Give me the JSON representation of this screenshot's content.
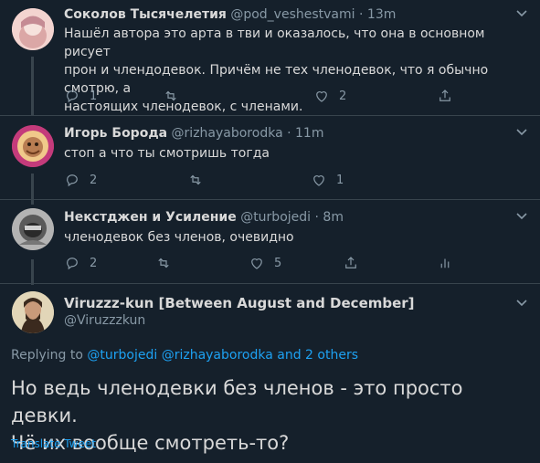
{
  "colors": {
    "background": "#15202b",
    "text": "#d9d9d9",
    "muted": "#8899a6",
    "link": "#1da1f2",
    "divider": "#38444d"
  },
  "tweets": [
    {
      "name": "Соколов Тысячелетия",
      "handle": "@pod_veshestvami",
      "sep": "·",
      "time": "13m",
      "text_lines": [
        "Нашёл автора это арта в тви и оказалось, что она в основном рисует",
        "прон и члендодевок. Причём не тех членодевок, что я обычно смотрю, а",
        "настоящих членодевок, с членами."
      ],
      "replies": "1",
      "retweets": "",
      "likes": "2"
    },
    {
      "name": "Игорь Борода",
      "handle": "@rizhayaborodka",
      "sep": "·",
      "time": "11m",
      "text_lines": [
        "стоп а что ты смотришь тогда"
      ],
      "replies": "2",
      "retweets": "",
      "likes": "1"
    },
    {
      "name": "Некстджен и Усиление",
      "handle": "@turbojedi",
      "sep": "·",
      "time": "8m",
      "text_lines": [
        "членодевок без членов, очевидно"
      ],
      "replies": "2",
      "retweets": "",
      "likes": "5"
    }
  ],
  "main_tweet": {
    "name": "Viruzzz-kun [Between August and December]",
    "handle": "@Viruzzzkun",
    "replying_prefix": "Replying to",
    "replying_user1": "@turbojedi",
    "replying_user2": "@rizhayaborodka",
    "replying_others": "and 2 others",
    "text_line1": "Но ведь членодевки без членов - это просто девки.",
    "text_line2": "Чё их вообще смотреть-то?",
    "translate": "Translate Tweet"
  },
  "icons": [
    "reply-icon",
    "retweet-icon",
    "like-icon",
    "share-icon",
    "analytics-icon",
    "chevron-down-icon"
  ]
}
